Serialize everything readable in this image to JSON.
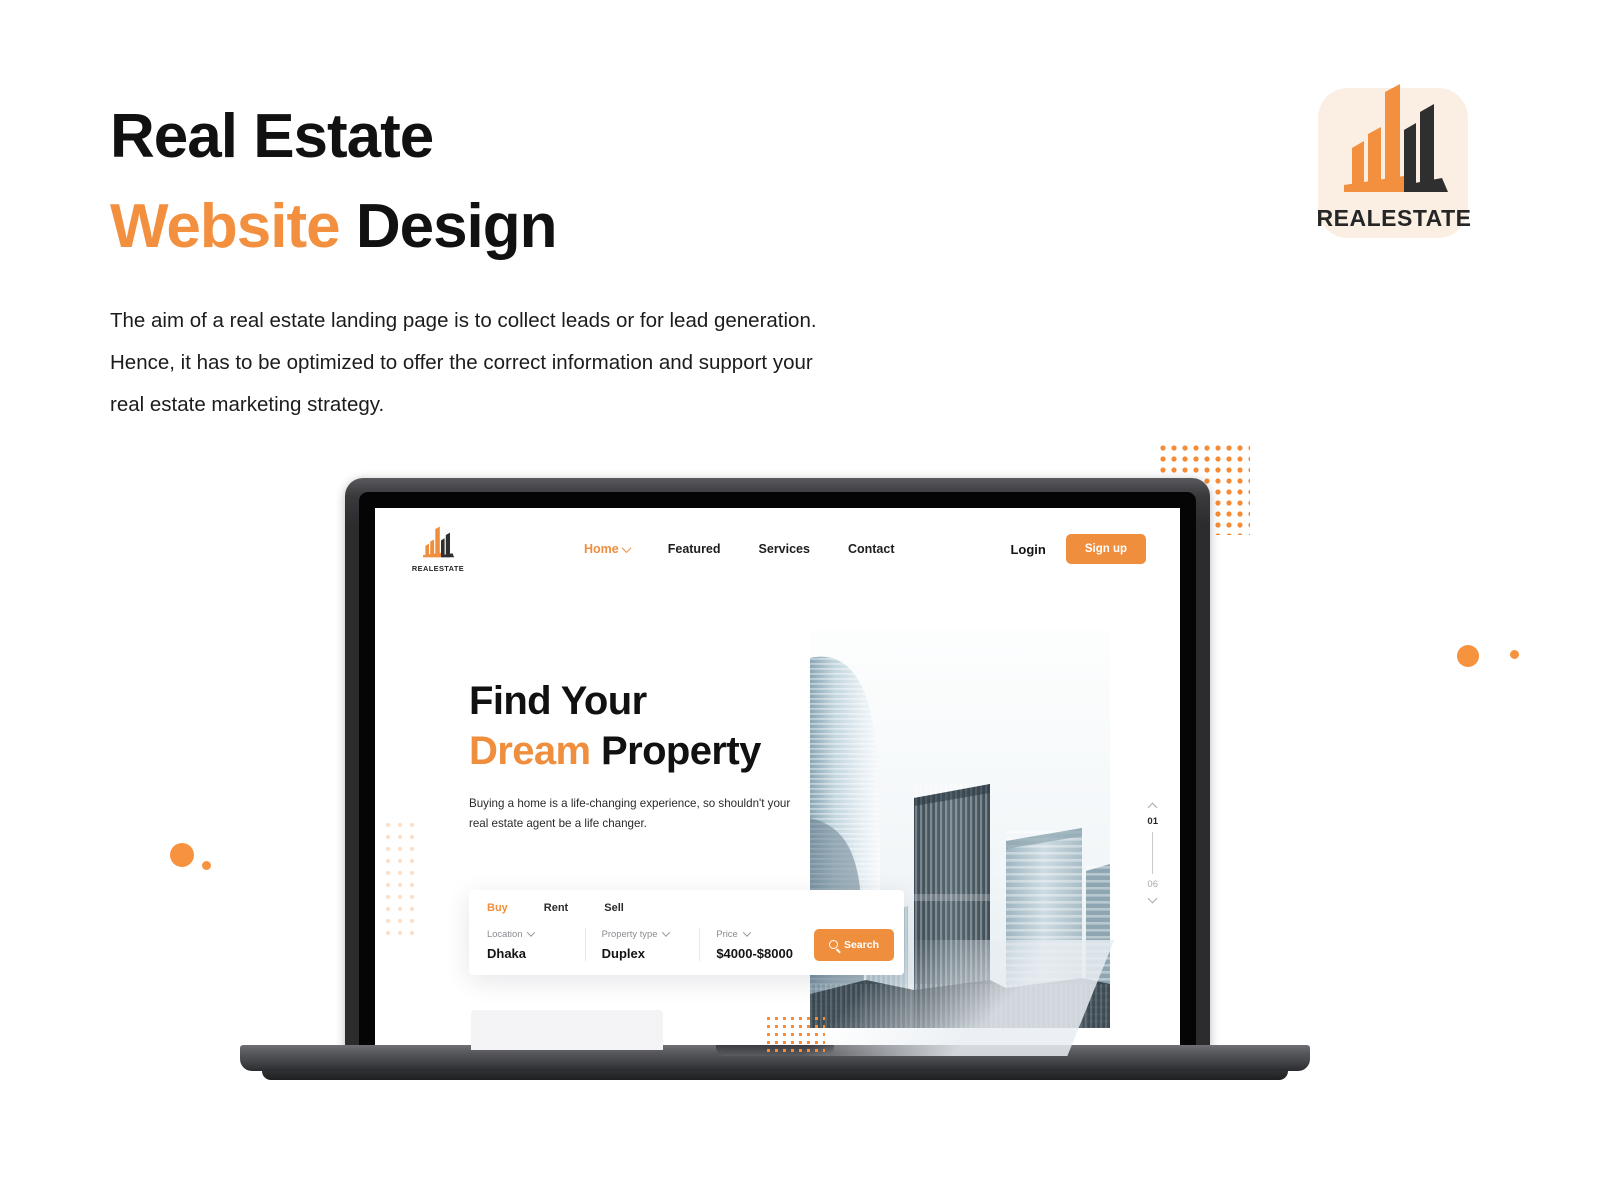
{
  "header": {
    "title_line1": "Real Estate",
    "title_line2_accent": "Website",
    "title_line2_rest": " Design",
    "description": "The aim of a real estate landing page is to collect leads or for lead generation. Hence, it has to be optimized to offer the correct information and support your real estate marketing strategy."
  },
  "brand": {
    "name": "REALESTATE",
    "logo_icon": "building-logo-icon",
    "tile_color": "#fbeee3",
    "accent_color": "#f2903f",
    "dark_color": "#2f2f2f"
  },
  "mockup": {
    "device": "laptop",
    "site": {
      "logo": {
        "name": "REALESTATE",
        "icon": "building-logo-icon"
      },
      "nav": {
        "links": [
          {
            "label": "Home",
            "active": true,
            "has_chevron": true
          },
          {
            "label": "Featured",
            "active": false,
            "has_chevron": false
          },
          {
            "label": "Services",
            "active": false,
            "has_chevron": false
          },
          {
            "label": "Contact",
            "active": false,
            "has_chevron": false
          }
        ],
        "login_label": "Login",
        "signup_label": "Sign up"
      },
      "hero": {
        "title_line1": "Find Your",
        "title_line2_accent": "Dream",
        "title_line2_rest": " Property",
        "subtitle": "Buying a home is a life-changing experience, so shouldn't your real estate agent be a life changer.",
        "photo_alt": "city-skyscrapers-photo"
      },
      "search": {
        "tabs": [
          {
            "label": "Buy",
            "active": true
          },
          {
            "label": "Rent",
            "active": false
          },
          {
            "label": "Sell",
            "active": false
          }
        ],
        "fields": [
          {
            "label": "Location",
            "value": "Dhaka"
          },
          {
            "label": "Property type",
            "value": "Duplex"
          },
          {
            "label": "Price",
            "value": "$4000-$8000"
          }
        ],
        "button_label": "Search"
      },
      "slider": {
        "current": "01",
        "total": "06"
      }
    }
  },
  "decor": {
    "dot_color": "#f68b36",
    "dot_color_faint": "#fbe0cb",
    "circle_color": "#f7933f"
  }
}
